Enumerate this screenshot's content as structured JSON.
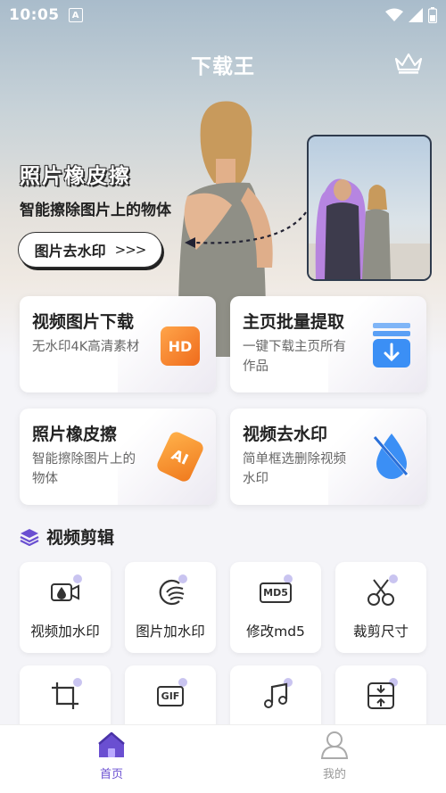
{
  "status_bar": {
    "time": "10:05",
    "a_icon": "A"
  },
  "header": {
    "title": "下载王",
    "crown_icon": "crown-icon"
  },
  "hero": {
    "heading": "照片橡皮擦",
    "subtitle": "智能擦除图片上的物体",
    "button_label": "图片去水印",
    "button_arrows": ">>>"
  },
  "features": [
    {
      "title": "视频图片下载",
      "desc": "无水印4K高清素材",
      "badge": "HD"
    },
    {
      "title": "主页批量提取",
      "desc": "一键下载主页所有作品",
      "badge": "download-icon"
    },
    {
      "title": "照片橡皮擦",
      "desc": "智能擦除图片上的物体",
      "badge": "AI"
    },
    {
      "title": "视频去水印",
      "desc": "简单框选删除视频水印",
      "badge": "no-water-icon"
    }
  ],
  "section": {
    "title": "视频剪辑",
    "icon": "layers-icon"
  },
  "tools": [
    {
      "label": "视频加水印",
      "icon": "video-watermark-icon"
    },
    {
      "label": "图片加水印",
      "icon": "image-watermark-icon"
    },
    {
      "label": "修改md5",
      "icon": "md5-icon",
      "icon_text": "MD5"
    },
    {
      "label": "裁剪尺寸",
      "icon": "scissors-icon"
    },
    {
      "label": "",
      "icon": "crop-icon"
    },
    {
      "label": "",
      "icon": "gif-icon",
      "icon_text": "GIF"
    },
    {
      "label": "",
      "icon": "music-icon"
    },
    {
      "label": "",
      "icon": "compress-icon"
    }
  ],
  "bottom_nav": [
    {
      "label": "首页",
      "icon": "home-icon",
      "active": true
    },
    {
      "label": "我的",
      "icon": "user-icon",
      "active": false
    }
  ],
  "colors": {
    "accent": "#6a4fd1",
    "inactive": "#999999",
    "orange": "#f08a2a",
    "blue": "#3b8ff5"
  }
}
